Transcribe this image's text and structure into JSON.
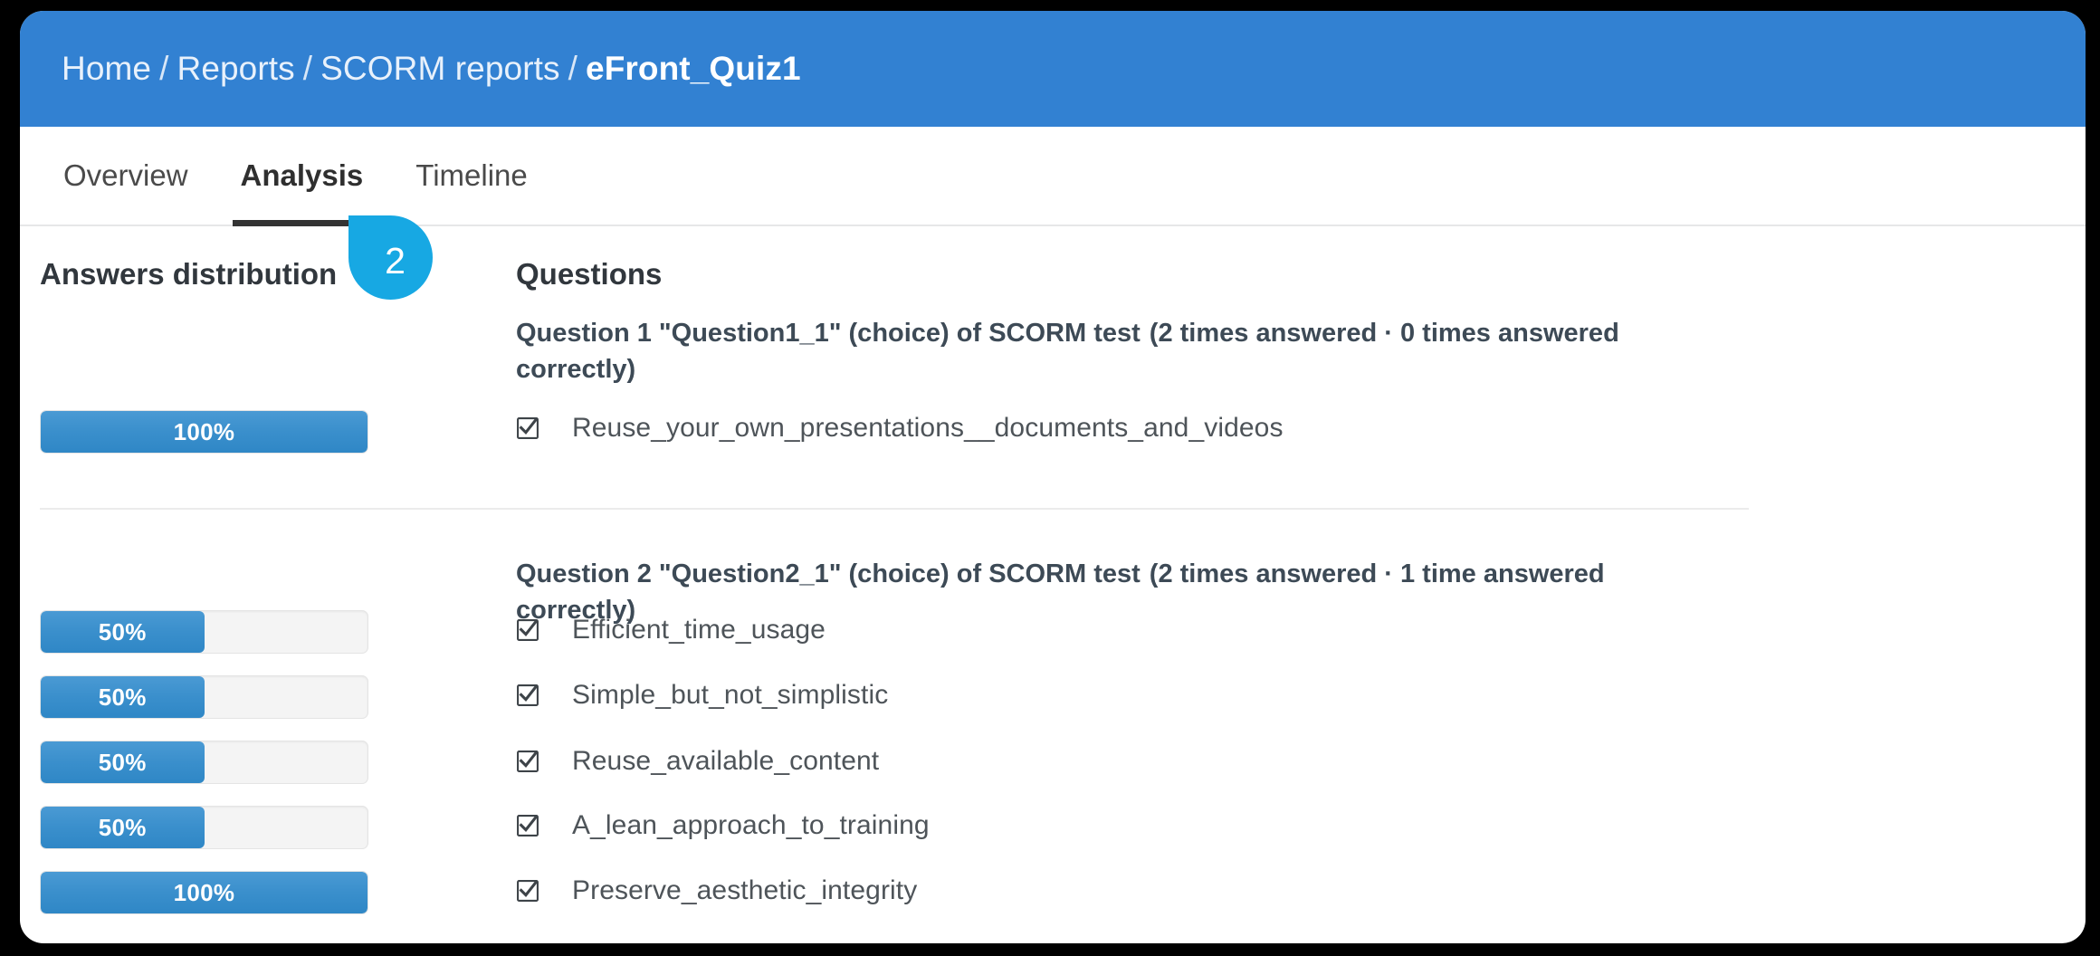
{
  "header": {
    "breadcrumb": [
      {
        "label": "Home",
        "current": false
      },
      {
        "label": "Reports",
        "current": false
      },
      {
        "label": "SCORM reports",
        "current": false
      },
      {
        "label": "eFront_Quiz1",
        "current": true
      }
    ],
    "separator": "/",
    "background_color": "#3281d2"
  },
  "tabs": [
    {
      "label": "Overview",
      "active": false
    },
    {
      "label": "Analysis",
      "active": true
    },
    {
      "label": "Timeline",
      "active": false
    }
  ],
  "step_marker": {
    "number": "2",
    "color": "#17a8e3"
  },
  "panels": {
    "left_heading": "Answers distribution",
    "right_heading": "Questions"
  },
  "questions": [
    {
      "title_main": "Question 1 \"Question1_1\" (choice) of SCORM test",
      "title_stats": "(2 times answered · 0 times answered correctly)",
      "answers": [
        {
          "label": "Reuse_your_own_presentations__documents_and_videos",
          "percent": 100,
          "percent_label": "100%",
          "icon": "checkbox-checked-icon"
        }
      ]
    },
    {
      "title_main": "Question 2 \"Question2_1\" (choice) of SCORM test",
      "title_stats": "(2 times answered · 1 time answered correctly)",
      "answers": [
        {
          "label": "Efficient_time_usage",
          "percent": 50,
          "percent_label": "50%",
          "icon": "checkbox-checked-icon"
        },
        {
          "label": "Simple_but_not_simplistic",
          "percent": 50,
          "percent_label": "50%",
          "icon": "checkbox-checked-icon"
        },
        {
          "label": "Reuse_available_content",
          "percent": 50,
          "percent_label": "50%",
          "icon": "checkbox-checked-icon"
        },
        {
          "label": "A_lean_approach_to_training",
          "percent": 50,
          "percent_label": "50%",
          "icon": "checkbox-checked-icon"
        },
        {
          "label": "Preserve_aesthetic_integrity",
          "percent": 100,
          "percent_label": "100%",
          "icon": "checkbox-checked-icon"
        }
      ]
    }
  ],
  "chart_data": {
    "type": "bar",
    "title": "Answers distribution",
    "orientation": "horizontal",
    "categories": [
      "Reuse_your_own_presentations__documents_and_videos",
      "Efficient_time_usage",
      "Simple_but_not_simplistic",
      "Reuse_available_content",
      "A_lean_approach_to_training",
      "Preserve_aesthetic_integrity"
    ],
    "values": [
      100,
      50,
      50,
      50,
      50,
      100
    ],
    "value_labels": [
      "100%",
      "50%",
      "50%",
      "50%",
      "50%",
      "100%"
    ],
    "xlabel": "",
    "ylabel": "",
    "xlim": [
      0,
      100
    ],
    "grid": false,
    "legend": false,
    "bar_color": "#3a8fcc",
    "track_color": "#f4f4f4"
  }
}
